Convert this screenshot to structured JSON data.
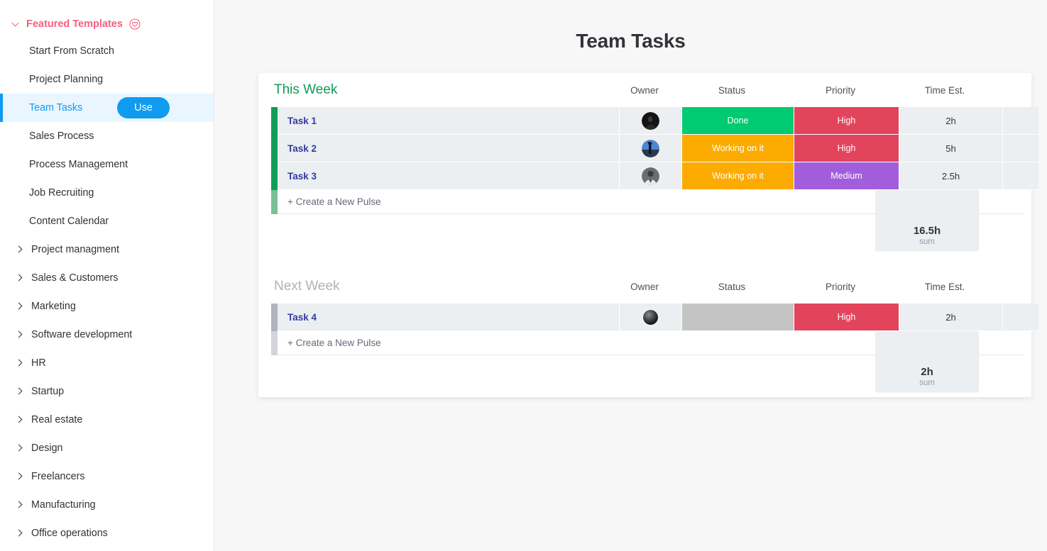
{
  "sidebar": {
    "featured": {
      "label": "Featured Templates",
      "chevron_icon": "chevron-down-icon",
      "badge_icon": "heart-circle-icon",
      "color": "#f65f7c"
    },
    "templates": [
      {
        "label": "Start From Scratch",
        "selected": false
      },
      {
        "label": "Project Planning",
        "selected": false
      },
      {
        "label": "Team Tasks",
        "selected": true,
        "action_label": "Use"
      },
      {
        "label": "Sales Process",
        "selected": false
      },
      {
        "label": "Process Management",
        "selected": false
      },
      {
        "label": "Job Recruiting",
        "selected": false
      },
      {
        "label": "Content Calendar",
        "selected": false
      }
    ],
    "groups": [
      {
        "label": "Project managment"
      },
      {
        "label": "Sales & Customers"
      },
      {
        "label": "Marketing"
      },
      {
        "label": "Software development"
      },
      {
        "label": "HR"
      },
      {
        "label": "Startup"
      },
      {
        "label": "Real estate"
      },
      {
        "label": "Design"
      },
      {
        "label": "Freelancers"
      },
      {
        "label": "Manufacturing"
      },
      {
        "label": "Office operations"
      }
    ],
    "group_chevron_icon": "chevron-right-icon"
  },
  "main": {
    "title": "Team Tasks"
  },
  "board": {
    "columns": [
      "Owner",
      "Status",
      "Priority",
      "Time Est."
    ],
    "add_row_label": "+ Create a New Pulse",
    "sum_label": "sum",
    "colors": {
      "done": "#00ca72",
      "working": "#fcab00",
      "high": "#e2445c",
      "medium": "#a25ddc",
      "empty": "#c4c4c4",
      "accent_green": "#0f9d58",
      "accent_gray": "#b0b3bb"
    },
    "groups": [
      {
        "title": "This Week",
        "title_color": "green",
        "accent": "green",
        "columns": [
          "Owner",
          "Status",
          "Priority",
          "Time Est."
        ],
        "rows": [
          {
            "name": "Task 1",
            "owner_avatar": "avatar-dark",
            "status": "Done",
            "status_color": "#00ca72",
            "priority": "High",
            "priority_color": "#e2445c",
            "time": "2h"
          },
          {
            "name": "Task 2",
            "owner_avatar": "avatar-sunset",
            "status": "Working on it",
            "status_color": "#fcab00",
            "priority": "High",
            "priority_color": "#e2445c",
            "time": "5h"
          },
          {
            "name": "Task 3",
            "owner_avatar": "avatar-person",
            "status": "Working on it",
            "status_color": "#fcab00",
            "priority": "Medium",
            "priority_color": "#a25ddc",
            "time": "2.5h"
          }
        ],
        "sum_value": "16.5h"
      },
      {
        "title": "Next Week",
        "title_color": "gray",
        "accent": "gray",
        "columns": [
          "Owner",
          "Status",
          "Priority",
          "Time Est."
        ],
        "rows": [
          {
            "name": "Task 4",
            "owner_avatar": "avatar-sphere",
            "status": "",
            "status_color": "#c4c4c4",
            "priority": "High",
            "priority_color": "#e2445c",
            "time": "2h"
          }
        ],
        "sum_value": "2h"
      }
    ]
  }
}
